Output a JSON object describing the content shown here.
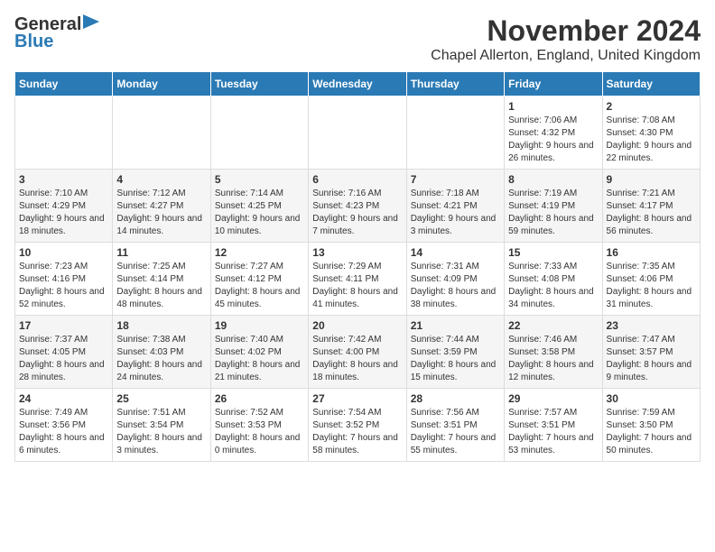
{
  "header": {
    "logo_general": "General",
    "logo_blue": "Blue",
    "month_title": "November 2024",
    "location": "Chapel Allerton, England, United Kingdom"
  },
  "days_of_week": [
    "Sunday",
    "Monday",
    "Tuesday",
    "Wednesday",
    "Thursday",
    "Friday",
    "Saturday"
  ],
  "weeks": [
    [
      {
        "day": "",
        "info": ""
      },
      {
        "day": "",
        "info": ""
      },
      {
        "day": "",
        "info": ""
      },
      {
        "day": "",
        "info": ""
      },
      {
        "day": "",
        "info": ""
      },
      {
        "day": "1",
        "info": "Sunrise: 7:06 AM\nSunset: 4:32 PM\nDaylight: 9 hours and 26 minutes."
      },
      {
        "day": "2",
        "info": "Sunrise: 7:08 AM\nSunset: 4:30 PM\nDaylight: 9 hours and 22 minutes."
      }
    ],
    [
      {
        "day": "3",
        "info": "Sunrise: 7:10 AM\nSunset: 4:29 PM\nDaylight: 9 hours and 18 minutes."
      },
      {
        "day": "4",
        "info": "Sunrise: 7:12 AM\nSunset: 4:27 PM\nDaylight: 9 hours and 14 minutes."
      },
      {
        "day": "5",
        "info": "Sunrise: 7:14 AM\nSunset: 4:25 PM\nDaylight: 9 hours and 10 minutes."
      },
      {
        "day": "6",
        "info": "Sunrise: 7:16 AM\nSunset: 4:23 PM\nDaylight: 9 hours and 7 minutes."
      },
      {
        "day": "7",
        "info": "Sunrise: 7:18 AM\nSunset: 4:21 PM\nDaylight: 9 hours and 3 minutes."
      },
      {
        "day": "8",
        "info": "Sunrise: 7:19 AM\nSunset: 4:19 PM\nDaylight: 8 hours and 59 minutes."
      },
      {
        "day": "9",
        "info": "Sunrise: 7:21 AM\nSunset: 4:17 PM\nDaylight: 8 hours and 56 minutes."
      }
    ],
    [
      {
        "day": "10",
        "info": "Sunrise: 7:23 AM\nSunset: 4:16 PM\nDaylight: 8 hours and 52 minutes."
      },
      {
        "day": "11",
        "info": "Sunrise: 7:25 AM\nSunset: 4:14 PM\nDaylight: 8 hours and 48 minutes."
      },
      {
        "day": "12",
        "info": "Sunrise: 7:27 AM\nSunset: 4:12 PM\nDaylight: 8 hours and 45 minutes."
      },
      {
        "day": "13",
        "info": "Sunrise: 7:29 AM\nSunset: 4:11 PM\nDaylight: 8 hours and 41 minutes."
      },
      {
        "day": "14",
        "info": "Sunrise: 7:31 AM\nSunset: 4:09 PM\nDaylight: 8 hours and 38 minutes."
      },
      {
        "day": "15",
        "info": "Sunrise: 7:33 AM\nSunset: 4:08 PM\nDaylight: 8 hours and 34 minutes."
      },
      {
        "day": "16",
        "info": "Sunrise: 7:35 AM\nSunset: 4:06 PM\nDaylight: 8 hours and 31 minutes."
      }
    ],
    [
      {
        "day": "17",
        "info": "Sunrise: 7:37 AM\nSunset: 4:05 PM\nDaylight: 8 hours and 28 minutes."
      },
      {
        "day": "18",
        "info": "Sunrise: 7:38 AM\nSunset: 4:03 PM\nDaylight: 8 hours and 24 minutes."
      },
      {
        "day": "19",
        "info": "Sunrise: 7:40 AM\nSunset: 4:02 PM\nDaylight: 8 hours and 21 minutes."
      },
      {
        "day": "20",
        "info": "Sunrise: 7:42 AM\nSunset: 4:00 PM\nDaylight: 8 hours and 18 minutes."
      },
      {
        "day": "21",
        "info": "Sunrise: 7:44 AM\nSunset: 3:59 PM\nDaylight: 8 hours and 15 minutes."
      },
      {
        "day": "22",
        "info": "Sunrise: 7:46 AM\nSunset: 3:58 PM\nDaylight: 8 hours and 12 minutes."
      },
      {
        "day": "23",
        "info": "Sunrise: 7:47 AM\nSunset: 3:57 PM\nDaylight: 8 hours and 9 minutes."
      }
    ],
    [
      {
        "day": "24",
        "info": "Sunrise: 7:49 AM\nSunset: 3:56 PM\nDaylight: 8 hours and 6 minutes."
      },
      {
        "day": "25",
        "info": "Sunrise: 7:51 AM\nSunset: 3:54 PM\nDaylight: 8 hours and 3 minutes."
      },
      {
        "day": "26",
        "info": "Sunrise: 7:52 AM\nSunset: 3:53 PM\nDaylight: 8 hours and 0 minutes."
      },
      {
        "day": "27",
        "info": "Sunrise: 7:54 AM\nSunset: 3:52 PM\nDaylight: 7 hours and 58 minutes."
      },
      {
        "day": "28",
        "info": "Sunrise: 7:56 AM\nSunset: 3:51 PM\nDaylight: 7 hours and 55 minutes."
      },
      {
        "day": "29",
        "info": "Sunrise: 7:57 AM\nSunset: 3:51 PM\nDaylight: 7 hours and 53 minutes."
      },
      {
        "day": "30",
        "info": "Sunrise: 7:59 AM\nSunset: 3:50 PM\nDaylight: 7 hours and 50 minutes."
      }
    ]
  ]
}
